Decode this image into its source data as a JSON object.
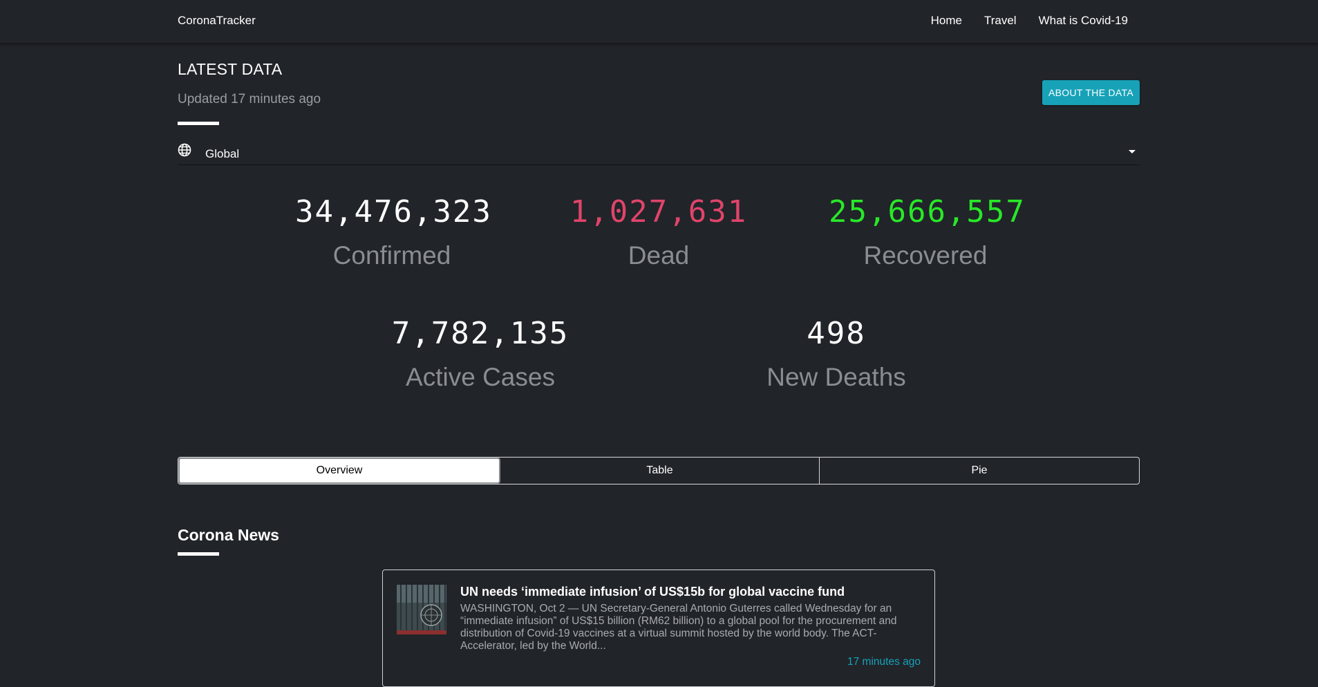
{
  "navbar": {
    "brand": "CoronaTracker",
    "links": [
      "Home",
      "Travel",
      "What is Covid-19"
    ]
  },
  "header": {
    "title": "LATEST DATA",
    "updated": "Updated 17 minutes ago",
    "about_button": "ABOUT THE DATA"
  },
  "region": {
    "icon": "globe-icon",
    "selected": "Global"
  },
  "stats": {
    "confirmed": {
      "value": "34,476,323",
      "label": "Confirmed",
      "color": "#ffffff"
    },
    "dead": {
      "value": "1,027,631",
      "label": "Dead",
      "color": "#e0446a"
    },
    "recovered": {
      "value": "25,666,557",
      "label": "Recovered",
      "color": "#28e828"
    },
    "active": {
      "value": "7,782,135",
      "label": "Active Cases",
      "color": "#ffffff"
    },
    "new_deaths": {
      "value": "498",
      "label": "New Deaths",
      "color": "#ffffff"
    }
  },
  "tabs": [
    "Overview",
    "Table",
    "Pie"
  ],
  "news": {
    "section_title": "Corona News",
    "articles": [
      {
        "headline": "UN needs ‘immediate infusion’ of US$15b for global vaccine fund",
        "snippet": "WASHINGTON, Oct 2 — UN Secretary-General Antonio Guterres called Wednesday for an “immediate infusion” of US$15 billion (RM62 billion) to a global pool for the procurement and distribution of Covid-19 vaccines at a virtual summit hosted by the world body. The ACT-Accelerator, led by the World...",
        "time": "17 minutes ago"
      }
    ]
  },
  "colors": {
    "background": "#212429",
    "accent": "#17a2b8",
    "muted": "#8a8d91"
  }
}
